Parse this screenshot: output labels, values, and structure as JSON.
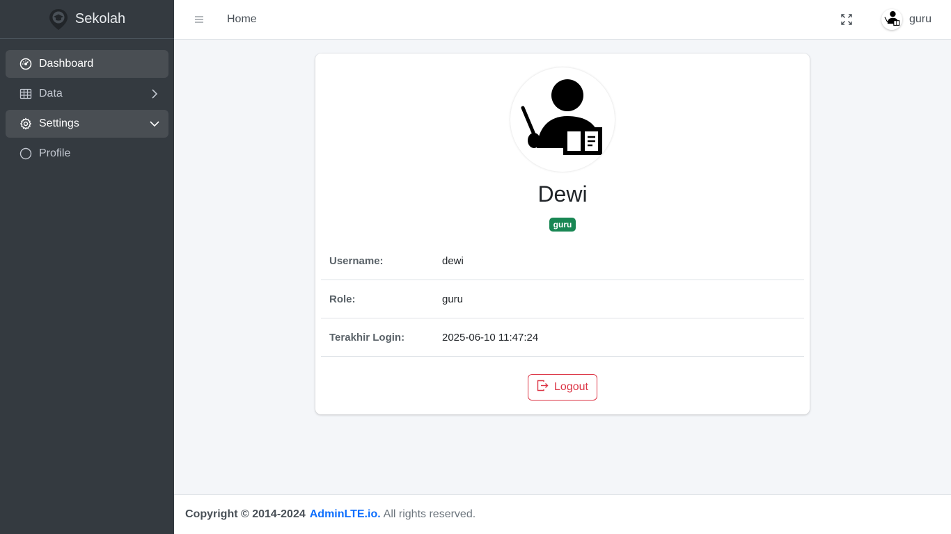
{
  "brand": {
    "name": "Sekolah",
    "logo_icon": "graduation-pin-icon"
  },
  "sidebar": {
    "items": [
      {
        "label": "Dashboard",
        "icon": "speedometer-icon",
        "active": true
      },
      {
        "label": "Data",
        "icon": "table-icon",
        "chevron": "chevron-right-icon"
      },
      {
        "label": "Settings",
        "icon": "gear-icon",
        "active": true,
        "chevron": "chevron-down-icon"
      },
      {
        "label": "Profile",
        "icon": "circle-icon"
      }
    ]
  },
  "header": {
    "menu_icon": "hamburger-icon",
    "home_label": "Home",
    "fullscreen_icon": "fullscreen-icon",
    "user_name": "guru"
  },
  "profile": {
    "name": "Dewi",
    "role_badge": "guru",
    "fields": [
      {
        "key": "Username:",
        "value": "dewi"
      },
      {
        "key": "Role:",
        "value": "guru"
      },
      {
        "key": "Terakhir Login:",
        "value": "2025-06-10 11:47:24"
      }
    ],
    "logout_label": "Logout"
  },
  "footer": {
    "copyright": "Copyright © 2014-2024",
    "link": "AdminLTE.io.",
    "rest": "All rights reserved."
  },
  "colors": {
    "sidebar_bg": "#343a40",
    "badge_green": "#198754",
    "danger": "#dc3545",
    "link_blue": "#0d6efd"
  }
}
